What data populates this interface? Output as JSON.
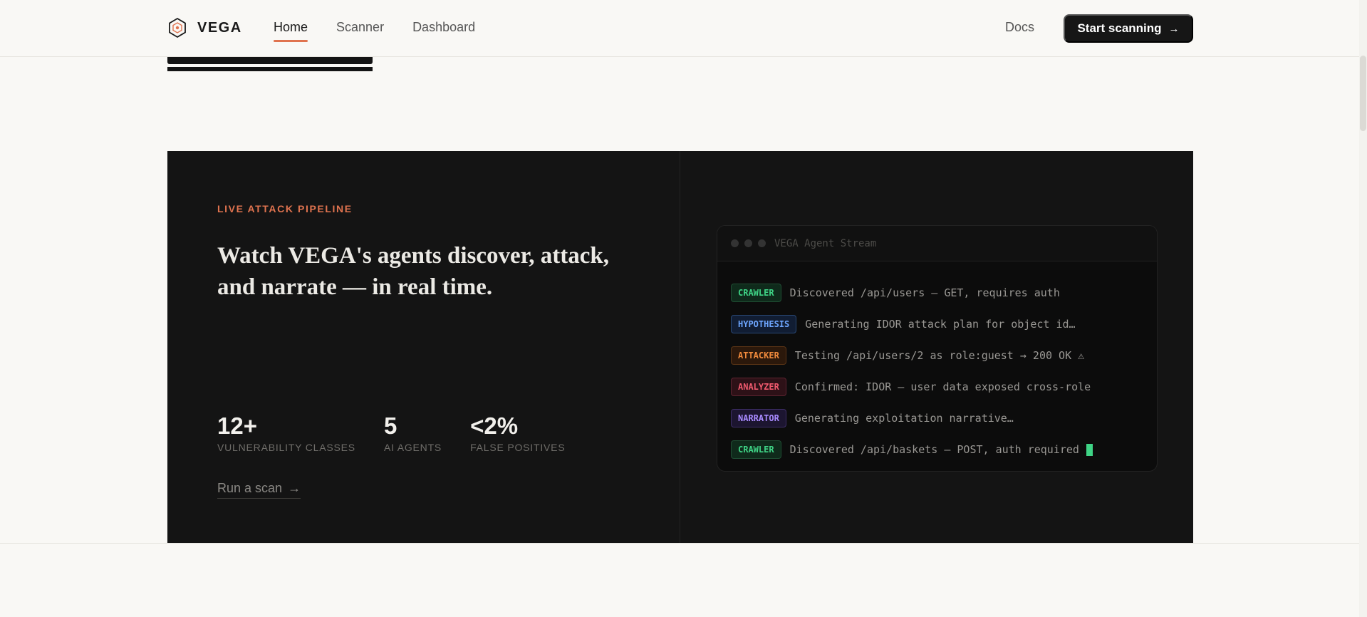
{
  "nav": {
    "brand": "VEGA",
    "links": [
      {
        "label": "Home",
        "active": true
      },
      {
        "label": "Scanner",
        "active": false
      },
      {
        "label": "Dashboard",
        "active": false
      }
    ],
    "docs": "Docs",
    "cta": "Start scanning"
  },
  "pipeline": {
    "eyebrow": "LIVE ATTACK PIPELINE",
    "headline": "Watch VEGA's agents discover, attack, and narrate — in real time.",
    "stats": [
      {
        "value": "12+",
        "label": "VULNERABILITY CLASSES"
      },
      {
        "value": "5",
        "label": "AI AGENTS"
      },
      {
        "value": "<2%",
        "label": "FALSE POSITIVES"
      }
    ],
    "run_link": "Run a scan"
  },
  "terminal": {
    "title": "VEGA Agent Stream",
    "lines": [
      {
        "tag": "CRAWLER",
        "message": "Discovered /api/users — GET, requires auth"
      },
      {
        "tag": "HYPOTHESIS",
        "message": "Generating IDOR attack plan for object id…"
      },
      {
        "tag": "ATTACKER",
        "message": "Testing /api/users/2 as role:guest → 200 OK ⚠"
      },
      {
        "tag": "ANALYZER",
        "message": "Confirmed: IDOR — user data exposed cross-role"
      },
      {
        "tag": "NARRATOR",
        "message": "Generating exploitation narrative…"
      },
      {
        "tag": "CRAWLER",
        "message": "Discovered /api/baskets — POST, auth required"
      }
    ]
  },
  "colors": {
    "accent": "#e0734f",
    "dark_panel": "#141414",
    "crawler": "#3fd486",
    "hypothesis": "#6ea6ff",
    "attacker": "#f08a3c",
    "analyzer": "#f05a6e",
    "narrator": "#a98bff"
  }
}
